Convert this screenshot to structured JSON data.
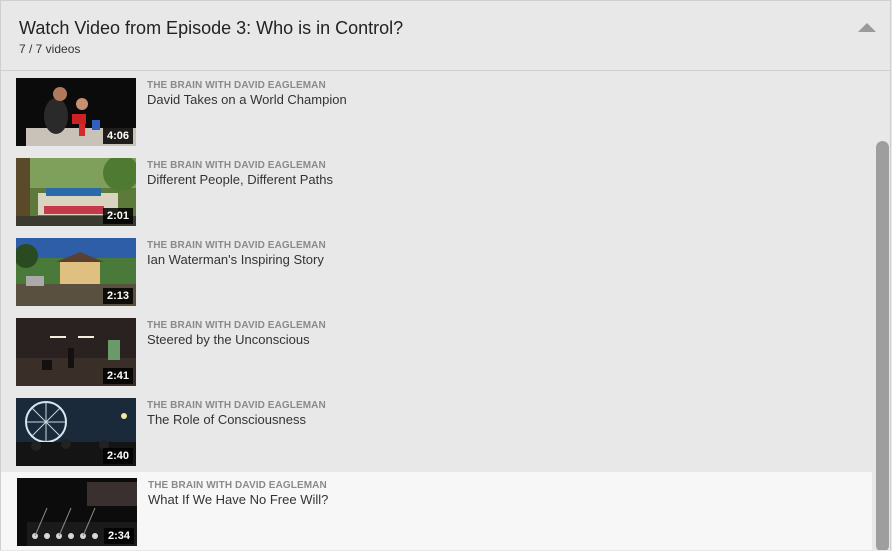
{
  "header": {
    "title": "Watch Video from Episode 3: Who is in Control?",
    "count": "7 / 7 videos",
    "collapse_icon": "chevron-up-icon"
  },
  "playlist": {
    "items": [
      {
        "series": "THE BRAIN WITH DAVID EAGLEMAN",
        "title": "David Takes on a World Champion",
        "duration": "4:06",
        "active": false
      },
      {
        "series": "THE BRAIN WITH DAVID EAGLEMAN",
        "title": "Different People, Different Paths",
        "duration": "2:01",
        "active": false
      },
      {
        "series": "THE BRAIN WITH DAVID EAGLEMAN",
        "title": "Ian Waterman's Inspiring Story",
        "duration": "2:13",
        "active": false
      },
      {
        "series": "THE BRAIN WITH DAVID EAGLEMAN",
        "title": "Steered by the Unconscious",
        "duration": "2:41",
        "active": false
      },
      {
        "series": "THE BRAIN WITH DAVID EAGLEMAN",
        "title": "The Role of Consciousness",
        "duration": "2:40",
        "active": false
      },
      {
        "series": "THE BRAIN WITH DAVID EAGLEMAN",
        "title": "What If We Have No Free Will?",
        "duration": "2:34",
        "active": true
      }
    ]
  },
  "colors": {
    "panel_bg": "#e8e8e8",
    "active_bg": "#f7f7f7",
    "series_text": "#8a8a8a",
    "scrollbar": "#9e9e9e"
  }
}
